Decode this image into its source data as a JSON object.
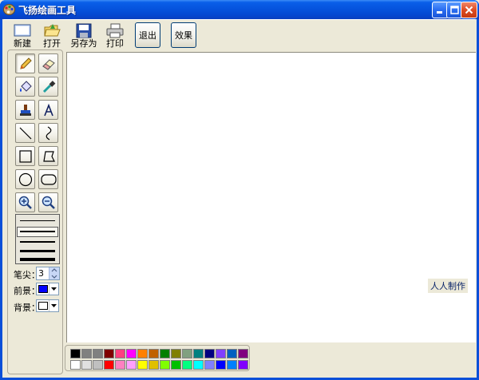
{
  "window": {
    "title": "飞扬绘画工具"
  },
  "toolbar": {
    "buttons": [
      {
        "label": "新建",
        "icon": "new-file-icon"
      },
      {
        "label": "打开",
        "icon": "open-folder-icon"
      },
      {
        "label": "另存为",
        "icon": "save-as-disk-icon"
      },
      {
        "label": "打印",
        "icon": "printer-icon"
      }
    ],
    "exit_label": "退出",
    "effect_label": "效果"
  },
  "tools": [
    {
      "name": "pencil",
      "icon": "pencil-icon",
      "active": true
    },
    {
      "name": "eraser",
      "icon": "eraser-icon",
      "active": false
    },
    {
      "name": "fill",
      "icon": "paint-bucket-icon",
      "active": false
    },
    {
      "name": "color-picker",
      "icon": "eyedropper-icon",
      "active": false
    },
    {
      "name": "stamp",
      "icon": "stamp-icon",
      "active": false
    },
    {
      "name": "text",
      "icon": "text-icon",
      "active": false
    },
    {
      "name": "line",
      "icon": "line-icon",
      "active": false
    },
    {
      "name": "curve",
      "icon": "curve-icon",
      "active": false
    },
    {
      "name": "rectangle",
      "icon": "rectangle-icon",
      "active": false
    },
    {
      "name": "polygon",
      "icon": "polygon-icon",
      "active": false
    },
    {
      "name": "ellipse",
      "icon": "ellipse-icon",
      "active": false
    },
    {
      "name": "rounded-rectangle",
      "icon": "rounded-rect-icon",
      "active": false
    },
    {
      "name": "zoom-in",
      "icon": "zoom-in-icon",
      "active": false
    },
    {
      "name": "zoom-out",
      "icon": "zoom-out-icon",
      "active": false
    }
  ],
  "options": {
    "pen_tip_label": "笔尖：",
    "pen_tip_value": "3",
    "foreground_label": "前景：",
    "foreground_color": "#0000ff",
    "background_label": "背景：",
    "background_color": "#ffffff"
  },
  "credit": "人人制作",
  "palette": {
    "row1": [
      "#000000",
      "#808080",
      "#808080",
      "#800000",
      "#ff4080",
      "#ff00ff",
      "#ff8000",
      "#c06000",
      "#008000",
      "#808000",
      "#80a080",
      "#008080",
      "#000080",
      "#8040ff",
      "#0060c0",
      "#800080"
    ],
    "row2": [
      "#ffffff",
      "#e0e0e0",
      "#c0c0c0",
      "#ff0000",
      "#ff80c0",
      "#ffa0ff",
      "#ffff00",
      "#e0c000",
      "#80ff00",
      "#00c000",
      "#00ff80",
      "#00ffff",
      "#8080ff",
      "#0000ff",
      "#0080ff",
      "#8000ff"
    ]
  }
}
